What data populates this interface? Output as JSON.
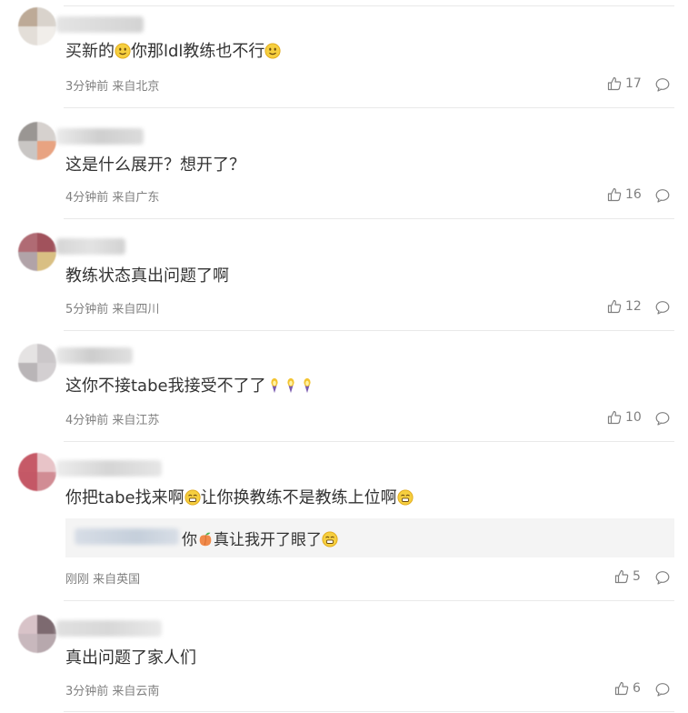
{
  "comments": [
    {
      "text_a": "买新的",
      "text_b": "你那ldl教练也不行",
      "time": "3分钟前",
      "location": "来自北京",
      "likes": "17",
      "like_icon": "thumbs-up-icon",
      "reply_icon": "comment-bubble-icon"
    },
    {
      "text": "这是什么展开？想开了？",
      "time": "4分钟前",
      "location": "来自广东",
      "likes": "16"
    },
    {
      "text": "教练状态真出问题了啊",
      "time": "5分钟前",
      "location": "来自四川",
      "likes": "12"
    },
    {
      "text": "这你不接tabe我接受不了了",
      "time": "4分钟前",
      "location": "来自江苏",
      "likes": "10"
    },
    {
      "text_a": "你把tabe找来啊",
      "text_b": "让你换教练不是教练上位啊",
      "quote_a": "你",
      "quote_b": "真让我开了眼了",
      "time": "刚刚",
      "location": "来自英国",
      "likes": "5"
    },
    {
      "text": "真出问题了家人们",
      "time": "3分钟前",
      "location": "来自云南",
      "likes": "6"
    }
  ],
  "colors": {
    "text": "#333333",
    "meta": "#808080",
    "divider": "#e9e9e9",
    "quote_bg": "#f4f4f4"
  }
}
